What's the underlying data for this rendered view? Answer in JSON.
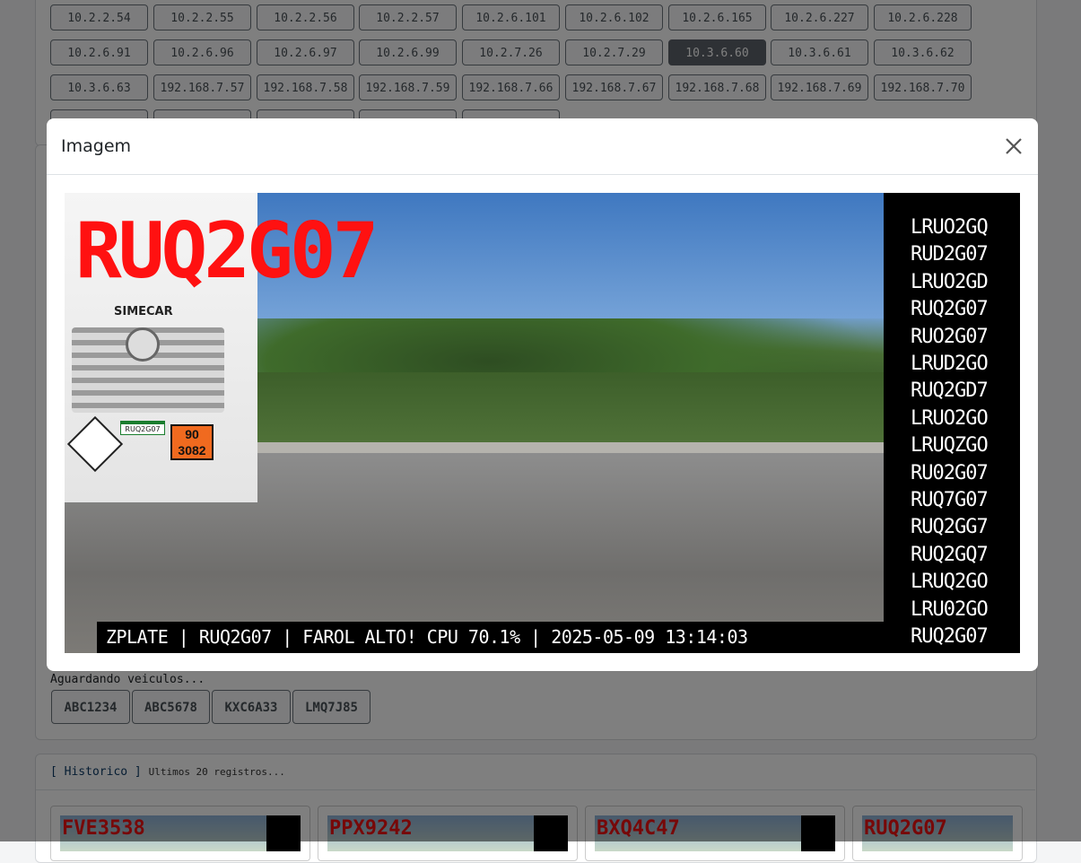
{
  "ip_buttons": [
    [
      "10.2.2.54",
      "10.2.2.55",
      "10.2.2.56",
      "10.2.2.57",
      "10.2.6.101",
      "10.2.6.102",
      "10.2.6.165",
      "10.2.6.227",
      "10.2.6.228"
    ],
    [
      "10.2.6.91",
      "10.2.6.96",
      "10.2.6.97",
      "10.2.6.99",
      "10.2.7.26",
      "10.2.7.29",
      "10.3.6.60",
      "10.3.6.61",
      "10.3.6.62"
    ],
    [
      "10.3.6.63",
      "192.168.7.57",
      "192.168.7.58",
      "192.168.7.59",
      "192.168.7.66",
      "192.168.7.67",
      "192.168.7.68",
      "192.168.7.69",
      "192.168.7.70"
    ]
  ],
  "active_ip": "10.3.6.60",
  "queue": {
    "waiting_text": "Aguardando veiculos...",
    "plates": [
      "ABC1234",
      "ABC5678",
      "KXC6A33",
      "LMQ7J85"
    ]
  },
  "history": {
    "title": "[ Historico ]",
    "subtitle": "Ultimos 20 registros...",
    "items": [
      "FVE3538",
      "PPX9242",
      "BXQ4C47",
      "RUQ2G07"
    ]
  },
  "modal": {
    "title": "Imagem",
    "image": {
      "plate_overlay": "RUQ2G07",
      "brand": "SIMECAR",
      "hazard_top": "90",
      "hazard_bottom": "3082",
      "vehicle_plate": "RUQ2G07",
      "candidates": [
        "LRUO2GQ",
        "RUD2G07",
        "LRUO2GD",
        "RUQ2G07",
        "RUO2G07",
        "LRUD2GO",
        "RUQ2GD7",
        "LRUO2GO",
        "LRUQZGO",
        "RU02G07",
        "RUQ7G07",
        "RUQ2GG7",
        "RUQ2GQ7",
        "LRUQ2GO",
        "LRU02GO",
        "RUQ2G07"
      ],
      "status_line": "ZPLATE | RUQ2G07 | FAROL ALTO! CPU 70.1% | 2025-05-09 13:14:03"
    }
  },
  "colors": {
    "plate_red": "#ff1111",
    "active_button": "#5c636a",
    "hazard_orange": "#f06a1f"
  }
}
